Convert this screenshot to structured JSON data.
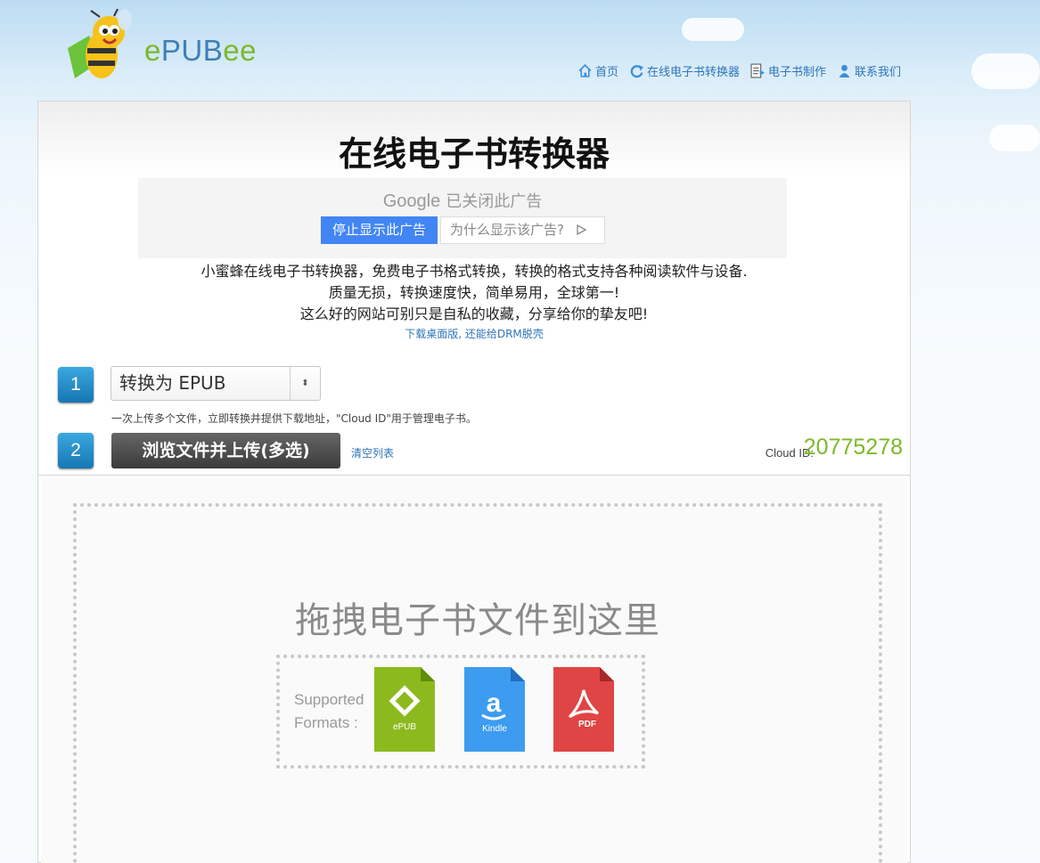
{
  "header": {
    "logo": {
      "e": "e",
      "pub": "PUB",
      "ee": "ee"
    },
    "nav": [
      {
        "label": "首页",
        "icon": "home-icon"
      },
      {
        "label": "在线电子书转换器",
        "icon": "refresh-icon"
      },
      {
        "label": "电子书制作",
        "icon": "document-icon"
      },
      {
        "label": "联系我们",
        "icon": "user-icon"
      }
    ]
  },
  "main": {
    "title": "在线电子书转换器",
    "ad": {
      "brand": "Google",
      "closed_text": "已关闭此广告",
      "stop_label": "停止显示此广告",
      "why_label": "为什么显示该广告?"
    },
    "description": [
      "小蜜蜂在线电子书转换器，免费电子书格式转换，转换的格式支持各种阅读软件与设备.",
      "质量无损，转换速度快，简单易用，全球第一!",
      "这么好的网站可别只是自私的收藏，分享给你的挚友吧!"
    ],
    "desktop_link": "下载桌面版, 还能给DRM脱壳"
  },
  "steps": {
    "step1_number": "1",
    "step2_number": "2",
    "format_select": "转换为 EPUB",
    "hint": "一次上传多个文件，立即转换并提供下载地址，\"Cloud ID\"用于管理电子书。",
    "upload_button": "浏览文件并上传(多选)",
    "clear_link": "清空列表",
    "cloud_label": "Cloud ID:",
    "cloud_id": "20775278"
  },
  "dropzone": {
    "title": "拖拽电子书文件到这里",
    "formats_label_1": "Supported",
    "formats_label_2": "Formats :",
    "formats": [
      {
        "name": "ePUB",
        "color": "#8cba1e"
      },
      {
        "name": "Kindle",
        "color": "#3d9cf0"
      },
      {
        "name": "PDF",
        "color": "#e04545"
      }
    ]
  },
  "colors": {
    "link": "#2f76b8",
    "accent_green": "#7cb829",
    "google_blue": "#4285f4"
  }
}
